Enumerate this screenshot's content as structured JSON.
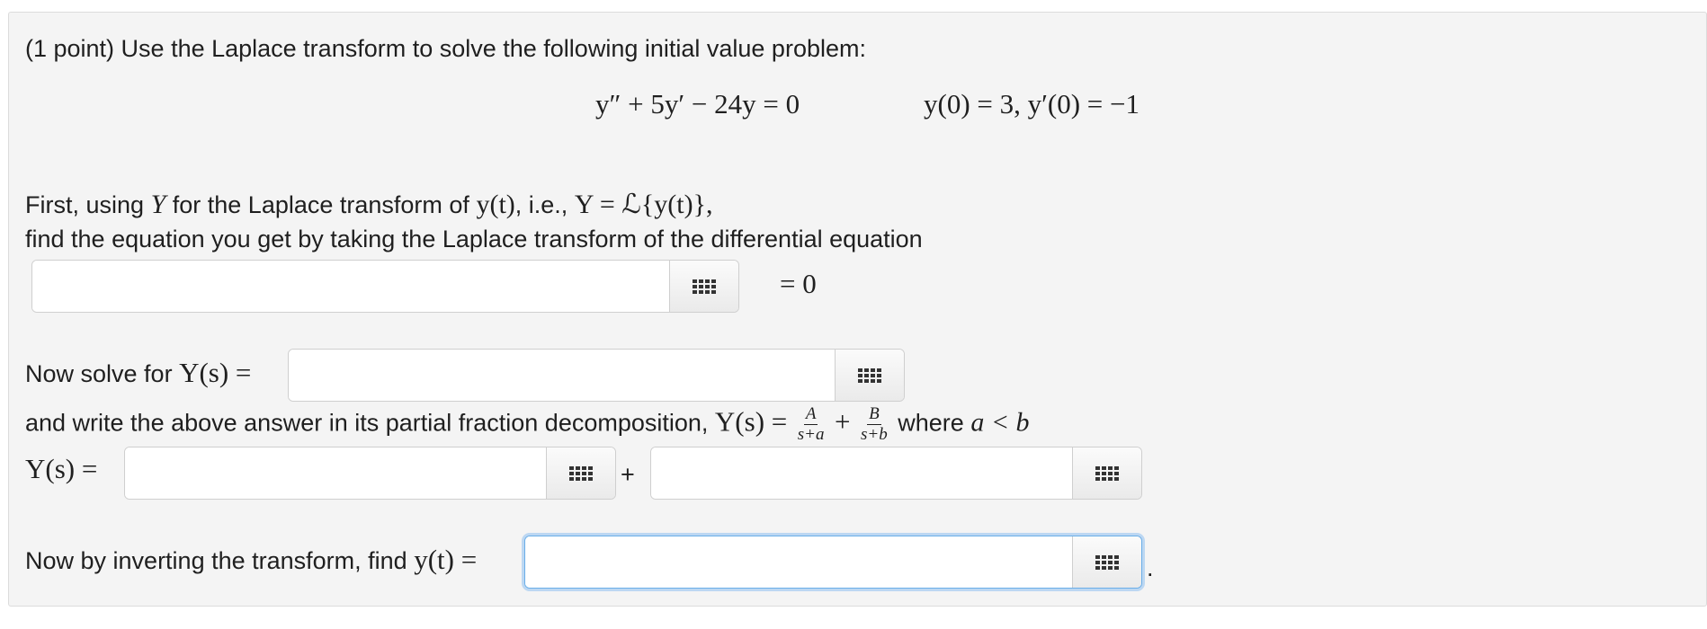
{
  "intro": "(1 point) Use the Laplace transform to solve the following initial value problem:",
  "ode": {
    "equation": "y″ + 5y′ − 24y = 0",
    "initial_conditions": "y(0) = 3,  y′(0) = −1"
  },
  "step1": {
    "text_before": "First, using",
    "symbol_Y": "Y",
    "text_middle": "for the Laplace transform of",
    "expr_yt": "y(t)",
    "text_ie": ", i.e.,",
    "definition": "Y = ℒ{y(t)},",
    "line2": "find the equation you get by taking the Laplace transform of the differential equation",
    "equals_suffix": "= 0",
    "input_value": ""
  },
  "step2": {
    "label_text": "Now solve for",
    "label_math": "Y(s) =",
    "input_value": ""
  },
  "step3": {
    "text": "and write the above answer in its partial fraction decomposition,",
    "lhs": "Y(s) =",
    "frac1_num": "A",
    "frac1_den": "s+a",
    "plus": "+",
    "frac2_num": "B",
    "frac2_den": "s+b",
    "where_text": "where",
    "condition": "a < b",
    "row_label": "Y(s) =",
    "input_A_value": "",
    "input_B_value": ""
  },
  "step4": {
    "label_text": "Now by inverting the transform, find",
    "label_math": "y(t) =",
    "input_value": "",
    "trailing_period": "."
  },
  "icons": {
    "palette": "equation-editor-grid-icon"
  },
  "colors": {
    "panel_bg": "#f4f4f4",
    "focus_ring": "#6aaee8"
  }
}
